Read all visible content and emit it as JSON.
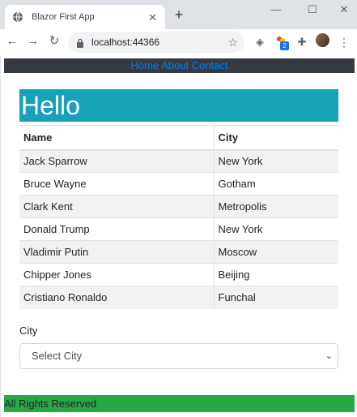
{
  "browser": {
    "tab_title": "Blazor First App",
    "tab_close": "✕",
    "new_tab": "+",
    "window": {
      "minimize": "—",
      "maximize": "☐",
      "close": "✕"
    },
    "nav": {
      "back": "←",
      "forward": "→",
      "reload": "↻"
    },
    "url": "localhost:44366",
    "star": "☆",
    "extensions": {
      "shield": "◈",
      "badge_count": "2",
      "puzzle": "✚"
    },
    "menu": "⋮"
  },
  "nav": {
    "home": "Home",
    "about": "About",
    "contact": "Contact"
  },
  "heading": "Hello",
  "table": {
    "headers": [
      "Name",
      "City"
    ],
    "rows": [
      [
        "Jack Sparrow",
        "New York"
      ],
      [
        "Bruce Wayne",
        "Gotham"
      ],
      [
        "Clark Kent",
        "Metropolis"
      ],
      [
        "Donald Trump",
        "New York"
      ],
      [
        "Vladimir Putin",
        "Moscow"
      ],
      [
        "Chipper Jones",
        "Beijing"
      ],
      [
        "Cristiano Ronaldo",
        "Funchal"
      ]
    ]
  },
  "form": {
    "city_label": "City",
    "select_value": "Select City",
    "chevron": "⌄"
  },
  "footer": "All Rights Reserved",
  "colors": {
    "navbar_bg": "#343a40",
    "link": "#007bff",
    "heading_bg": "#17a2b8",
    "footer_bg": "#28a745",
    "badge": "#1a73e8"
  }
}
